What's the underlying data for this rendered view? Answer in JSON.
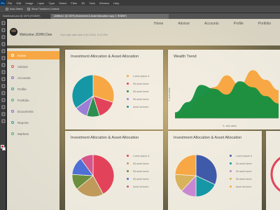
{
  "photoshop": {
    "logo": "Ps",
    "menu": [
      "File",
      "Edit",
      "Image",
      "Layer",
      "Type",
      "Select",
      "Filter",
      "3D",
      "View",
      "Window",
      "Help"
    ],
    "options": [
      "Auto-Select:",
      "Show Transform Controls"
    ],
    "tabs": [
      "Dashboard.psd @ 100% (RGB/8*)",
      "Untitled-1 @ 100% (Investment & Asset Allocation copy 2, RGB/8*)"
    ],
    "tools": [
      "move-icon",
      "marquee-icon",
      "lasso-icon",
      "crop-icon",
      "eyedropper-icon",
      "brush-icon",
      "stamp-icon",
      "eraser-icon",
      "gradient-icon",
      "pen-icon",
      "type-icon",
      "path-select-icon",
      "shape-icon",
      "hand-icon",
      "zoom-icon"
    ],
    "colors": {
      "foreground": "#d82b2b",
      "background": "#ffffff"
    }
  },
  "app": {
    "nav": [
      "Home",
      "Advisor",
      "Accounts",
      "Profile",
      "Portfolio"
    ],
    "welcome": "Welcome JOHN Doe",
    "last_login": "Your last visit was 4.24.2016, 3:12 PM",
    "sidebar": [
      {
        "label": "Home",
        "color": "#f7a844",
        "active": true
      },
      {
        "label": "Advisor",
        "color": "#e25858",
        "active": false
      },
      {
        "label": "Accounts",
        "color": "#8a6bc9",
        "active": false
      },
      {
        "label": "Profile",
        "color": "#3aa0a8",
        "active": false
      },
      {
        "label": "Portfolio",
        "color": "#4db56a",
        "active": false
      },
      {
        "label": "Documents",
        "color": "#8a6bc9",
        "active": false
      },
      {
        "label": "Reports",
        "color": "#3aa0a8",
        "active": false
      },
      {
        "label": "Markets",
        "color": "#4db56a",
        "active": false
      }
    ],
    "accent": "#f7a844"
  },
  "cards": {
    "pie1": {
      "title": "Investment Allocation & Asset Allocation",
      "legend": [
        "Lorem ipsum d",
        "Sit amet lorem",
        "Sit amet lorem",
        "Sit amet lorem",
        "Amet sit lorem"
      ]
    },
    "wealth": {
      "title": "Wealth Trend",
      "ylabel": "Y- axis value",
      "xlabel": "X- axis value"
    },
    "pie2": {
      "title": "Investment Allocation & Asset Allocation",
      "legend": [
        "Lorem ipsum d",
        "Sit amet lorem",
        "Sit amet lorem",
        "Sit amet lorem",
        "Amet sit lorem"
      ]
    },
    "pie3": {
      "title": "Investment Allocation & Asset Allocation",
      "legend": [
        "Lorem ipsum d",
        "Sit amet lorem",
        "Sit amet lorem",
        "Sit amet lorem",
        "Amet sit lorem"
      ]
    }
  },
  "chart_data": [
    {
      "type": "pie",
      "title": "Investment Allocation & Asset Allocation",
      "categories": [
        "Lorem ipsum d",
        "Sit amet lorem",
        "Sit amet lorem",
        "Sit amet lorem",
        "Amet sit lorem"
      ],
      "values": [
        30,
        15,
        10,
        10,
        35
      ],
      "colors": [
        "#f7a844",
        "#e2435a",
        "#2c8f4f",
        "#9b7fd6",
        "#1597a5"
      ]
    },
    {
      "type": "area",
      "title": "Wealth Trend",
      "xlabel": "X- axis value",
      "ylabel": "Y- axis value",
      "x": [
        0,
        1,
        2,
        3,
        4,
        5,
        6,
        7,
        8
      ],
      "series": [
        {
          "values": [
            5,
            12,
            30,
            42,
            58,
            45,
            65,
            52,
            38
          ],
          "color": "#f7a844"
        },
        {
          "values": [
            8,
            22,
            45,
            40,
            32,
            50,
            42,
            30,
            20
          ],
          "color": "#128e3f"
        }
      ]
    },
    {
      "type": "pie",
      "title": "Investment Allocation & Asset Allocation",
      "categories": [
        "Lorem ipsum d",
        "Sit amet lorem",
        "Sit amet lorem",
        "Sit amet lorem",
        "Amet sit lorem"
      ],
      "values": [
        42,
        22,
        12,
        14,
        10
      ],
      "colors": [
        "#e2435a",
        "#bf9a5a",
        "#6b8f3f",
        "#4d6fd6",
        "#d4568a"
      ]
    },
    {
      "type": "pie",
      "title": "Investment Allocation & Asset Allocation",
      "categories": [
        "Lorem ipsum d",
        "Sit amet lorem",
        "Sit amet lorem",
        "Sit amet lorem",
        "Amet sit lorem"
      ],
      "values": [
        32,
        18,
        12,
        14,
        24
      ],
      "colors": [
        "#3f5aa8",
        "#1597a5",
        "#c987d1",
        "#d9b25c",
        "#f7a844"
      ]
    }
  ]
}
